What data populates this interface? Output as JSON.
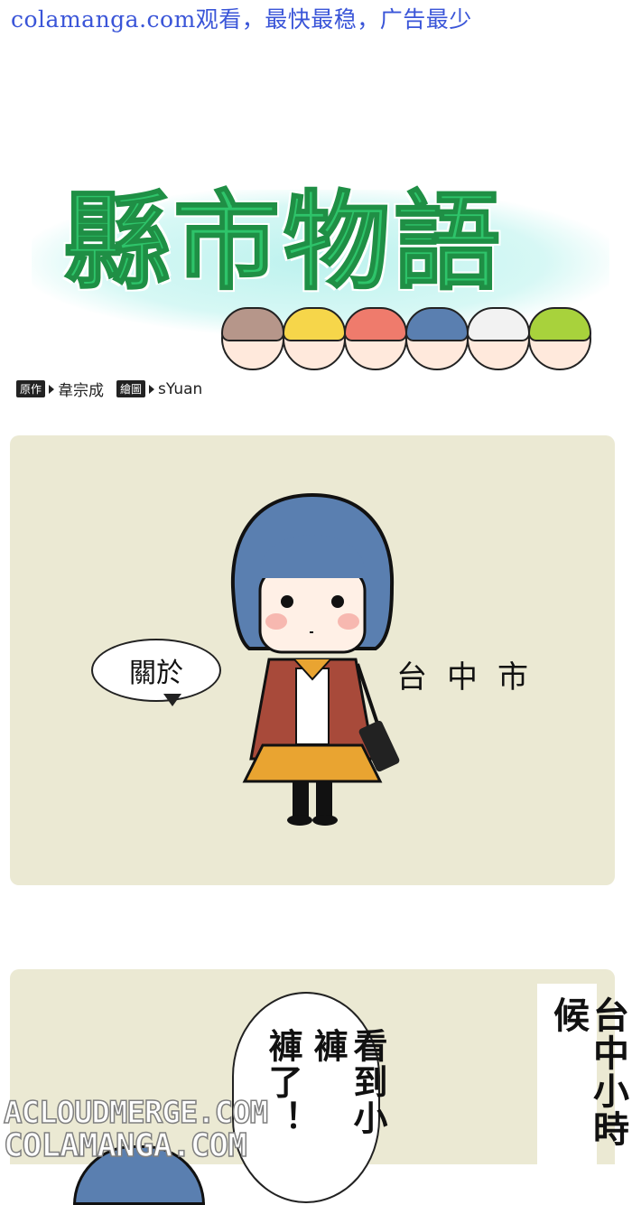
{
  "banner": "colamanga.com观看，最快最稳，广告最少",
  "title": "縣市物語",
  "credits": {
    "author_tag": "原作",
    "author": "韋宗成",
    "artist_tag": "繪圖",
    "artist": "sYuan"
  },
  "panel1": {
    "bubble": "關於",
    "caption": "台中市"
  },
  "panel2": {
    "bubble_line1": "看到小褲",
    "bubble_line2": "褲了！",
    "caption": "台中小時候"
  },
  "watermarks": [
    "ACLOUDMERGE.COM",
    "COLAMANGA.COM"
  ],
  "colors": {
    "banner": "#3a55d8",
    "title": "#2ec46a",
    "panel_bg": "#ebe9d3",
    "hair": "#5a7fb0"
  }
}
